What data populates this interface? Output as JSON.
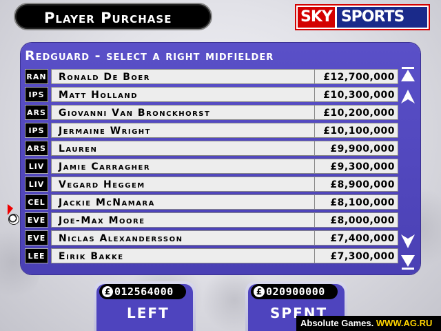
{
  "header": {
    "title": "Player Purchase",
    "logo_sky": "SKY",
    "logo_sports": "SPORTS"
  },
  "panel": {
    "heading": "Redguard - select a right midfielder"
  },
  "players": [
    {
      "club": "RAN",
      "name": "Ronald De Boer",
      "price": "£12,700,000"
    },
    {
      "club": "IPS",
      "name": "Matt Holland",
      "price": "£10,300,000"
    },
    {
      "club": "ARS",
      "name": "Giovanni Van Bronckhorst",
      "price": "£10,200,000"
    },
    {
      "club": "IPS",
      "name": "Jermaine Wright",
      "price": "£10,100,000"
    },
    {
      "club": "ARS",
      "name": "Lauren",
      "price": "£9,900,000"
    },
    {
      "club": "LIV",
      "name": "Jamie Carragher",
      "price": "£9,300,000"
    },
    {
      "club": "LIV",
      "name": "Vegard Heggem",
      "price": "£8,900,000"
    },
    {
      "club": "CEL",
      "name": "Jackie McNamara",
      "price": "£8,100,000"
    },
    {
      "club": "EVE",
      "name": "Joe-Max Moore",
      "price": "£8,000,000"
    },
    {
      "club": "EVE",
      "name": "Niclas Alexandersson",
      "price": "£7,400,000"
    },
    {
      "club": "LEE",
      "name": "Eirik Bakke",
      "price": "£7,300,000"
    }
  ],
  "scroll": {
    "top_icon": "double-up-arrow-icon",
    "up_icon": "up-arrow-icon",
    "down_icon": "down-arrow-icon",
    "bottom_icon": "double-down-arrow-icon"
  },
  "budget": {
    "currency": "£",
    "left_value": "012564000",
    "left_label": "LEFT",
    "spent_value": "020900000",
    "spent_label": "SPENT"
  },
  "watermark": {
    "text": "Absolute Games.",
    "url": "WWW.AG.RU"
  },
  "colors": {
    "panel": "#5a50c8",
    "sky_red": "#d40000",
    "sports_blue": "#1a2a8a"
  }
}
